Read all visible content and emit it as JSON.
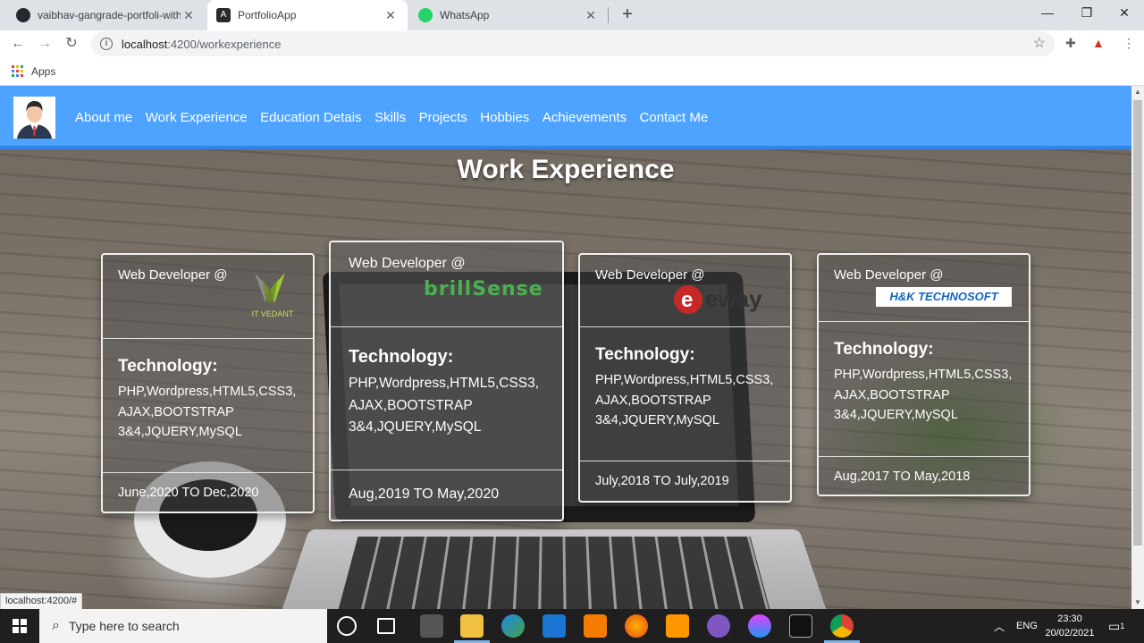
{
  "browser": {
    "tabs": [
      {
        "title": "vaibhav-gangrade-portfoli-with-a",
        "active": false,
        "icon": "github-icon"
      },
      {
        "title": "PortfolioApp",
        "active": true,
        "icon": "angular-icon"
      },
      {
        "title": "WhatsApp",
        "active": false,
        "icon": "whatsapp-icon"
      }
    ],
    "url_host": "localhost",
    "url_path": ":4200/workexperience",
    "bookmarks_apps": "Apps",
    "status_url": "localhost:4200/#"
  },
  "navbar": {
    "links": [
      "About me",
      "Work Experience",
      "Education Detais",
      "Skills",
      "Projects",
      "Hobbies",
      "Achievements",
      "Contact Me"
    ]
  },
  "page": {
    "title": "Work Experience"
  },
  "cards": [
    {
      "role": "Web Developer @",
      "company_logo": "IT VEDANT",
      "tech_title": "Technology:",
      "tech_lines": [
        "PHP,Wordpress,HTML5,CSS3,",
        "AJAX,BOOTSTRAP",
        "3&4,JQUERY,MySQL"
      ],
      "dates": "June,2020 TO Dec,2020"
    },
    {
      "role": "Web Developer @",
      "company_logo": "brillSense",
      "tech_title": "Technology:",
      "tech_lines": [
        "PHP,Wordpress,HTML5,CSS3,",
        "AJAX,BOOTSTRAP",
        "3&4,JQUERY,MySQL"
      ],
      "dates": "Aug,2019 TO May,2020"
    },
    {
      "role": "Web Developer @",
      "company_logo": "eway",
      "tech_title": "Technology:",
      "tech_lines": [
        "PHP,Wordpress,HTML5,CSS3,",
        "AJAX,BOOTSTRAP",
        "3&4,JQUERY,MySQL"
      ],
      "dates": "July,2018 TO July,2019"
    },
    {
      "role": "Web Developer @",
      "company_logo": "H&K TECHNOSOFT",
      "tech_title": "Technology:",
      "tech_lines": [
        "PHP,Wordpress,HTML5,CSS3,",
        "AJAX,BOOTSTRAP",
        "3&4,JQUERY,MySQL"
      ],
      "dates": "Aug,2017 TO May,2018"
    }
  ],
  "taskbar": {
    "search_placeholder": "Type here to search",
    "language": "ENG",
    "time": "23:30",
    "date": "20/02/2021",
    "notification_count": "1"
  },
  "colors": {
    "navbar": "#4da3ff",
    "taskbar": "#1f1f1f"
  }
}
